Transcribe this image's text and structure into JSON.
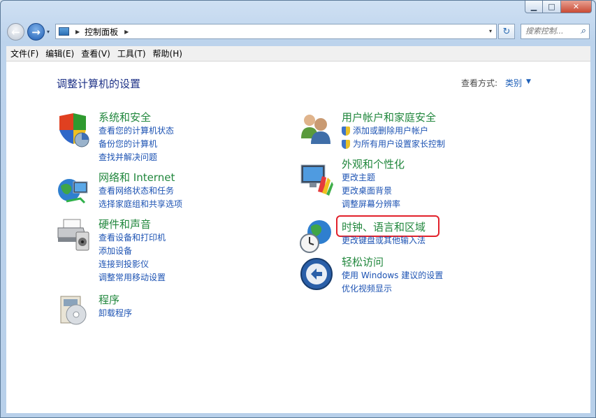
{
  "window": {
    "caption_min": "▁",
    "caption_max": "□",
    "caption_close": "✕"
  },
  "nav": {
    "back": "←",
    "forward": "→",
    "dropdown": "▾"
  },
  "address": {
    "sep": "▶",
    "crumb": "控制面板",
    "sep2": "▶",
    "dropdown": "▾"
  },
  "refresh_glyph": "↻",
  "search": {
    "placeholder": "搜索控制...",
    "icon": "⌕"
  },
  "menubar": [
    "文件(F)",
    "编辑(E)",
    "查看(V)",
    "工具(T)",
    "帮助(H)"
  ],
  "page": {
    "title": "调整计算机的设置",
    "view_by_label": "查看方式:",
    "view_by_value": "类别",
    "view_by_arrow": "▼"
  },
  "left_categories": [
    {
      "title": "系统和安全",
      "icon": "security-shield-icon",
      "links": [
        "查看您的计算机状态",
        "备份您的计算机",
        "查找并解决问题"
      ]
    },
    {
      "title": "网络和 Internet",
      "icon": "network-globe-icon",
      "links": [
        "查看网络状态和任务",
        "选择家庭组和共享选项"
      ]
    },
    {
      "title": "硬件和声音",
      "icon": "printer-speaker-icon",
      "links": [
        "查看设备和打印机",
        "添加设备",
        "连接到投影仪",
        "调整常用移动设置"
      ]
    },
    {
      "title": "程序",
      "icon": "programs-disc-icon",
      "links": [
        "卸载程序"
      ]
    }
  ],
  "right_categories": [
    {
      "title": "用户帐户和家庭安全",
      "icon": "users-icon",
      "links": [
        "添加或删除用户帐户",
        "为所有用户设置家长控制"
      ],
      "shield_links": true
    },
    {
      "title": "外观和个性化",
      "icon": "monitor-palette-icon",
      "links": [
        "更改主题",
        "更改桌面背景",
        "调整屏幕分辨率"
      ]
    },
    {
      "title": "时钟、语言和区域",
      "icon": "clock-globe-icon",
      "links": [
        "更改键盘或其他输入法"
      ],
      "highlighted": true
    },
    {
      "title": "轻松访问",
      "icon": "ease-of-access-icon",
      "links": [
        "使用 Windows 建议的设置",
        "优化视频显示"
      ]
    }
  ],
  "colors": {
    "category_title": "#21873d",
    "link": "#1d53b3",
    "highlight_border": "#e2212b"
  }
}
